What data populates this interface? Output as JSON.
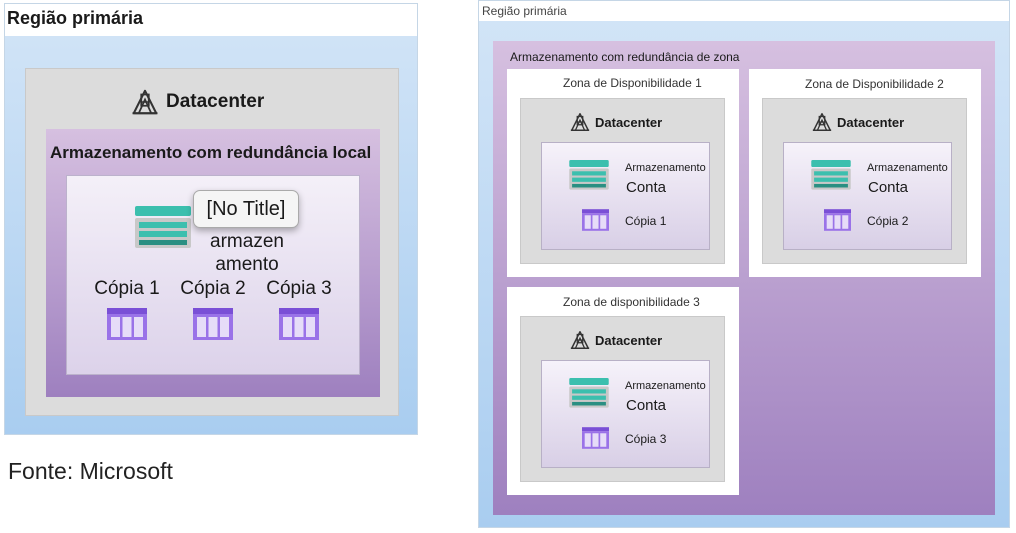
{
  "source_caption": "Fonte: Microsoft",
  "lrs": {
    "region_title": "Região primária",
    "datacenter_label": "Datacenter",
    "redundancy_label": "Armazenamento com redundância local",
    "tooltip": "[No Title]",
    "account_label_line1": "armazen",
    "account_label_line2": "amento",
    "copies": [
      "Cópia 1",
      "Cópia 2",
      "Cópia 3"
    ]
  },
  "zrs": {
    "region_title": "Região primária",
    "redundancy_label": "Armazenamento com redundância de zona",
    "zones": [
      {
        "title": "Zona de Disponibilidade 1",
        "datacenter_label": "Datacenter",
        "storage_label": "Armazenamento",
        "account_label": "Conta",
        "copy_label": "Cópia 1"
      },
      {
        "title": "Zona de Disponibilidade 2",
        "datacenter_label": "Datacenter",
        "storage_label": "Armazenamento",
        "account_label": "Conta",
        "copy_label": "Cópia 2"
      },
      {
        "title": "Zona de disponibilidade 3",
        "datacenter_label": "Datacenter",
        "storage_label": "Armazenamento",
        "account_label": "Conta",
        "copy_label": "Cópia 3"
      }
    ]
  },
  "colors": {
    "region_blue": "#a9cdf0",
    "purple": "#9e80bf",
    "teal": "#3cbfae",
    "copy_purple": "#7a4fd6"
  }
}
